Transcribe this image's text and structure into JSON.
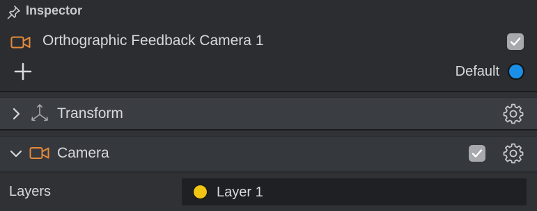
{
  "header": {
    "title": "Inspector",
    "icon": "pin-icon"
  },
  "object": {
    "name": "Orthographic Feedback Camera 1",
    "icon": "camera-icon",
    "enabled": true,
    "accent_color": "#e58a3a"
  },
  "layer_row": {
    "add_icon": "plus-icon",
    "layer_label": "Default",
    "layer_color": "#1b8fe6"
  },
  "components": [
    {
      "label": "Transform",
      "icon": "transform-axes-icon",
      "expanded": false,
      "settings_icon": "gear-icon"
    },
    {
      "label": "Camera",
      "icon": "camera-icon",
      "expanded": true,
      "enabled": true,
      "settings_icon": "gear-icon"
    }
  ],
  "camera_properties": {
    "layers_label": "Layers",
    "layers_value": "Layer 1",
    "layers_color": "#f2c515"
  }
}
